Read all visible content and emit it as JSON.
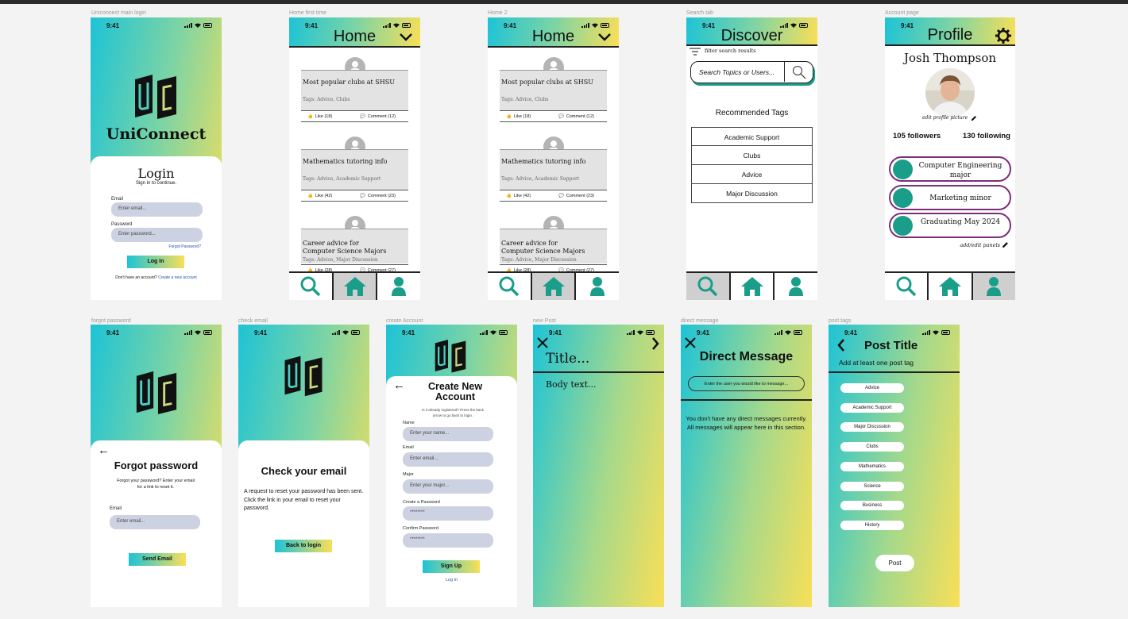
{
  "status_time": "9:41",
  "frames": {
    "login": {
      "name": "Uniconnect main login",
      "logo_text": "UC",
      "app_name": "UniConnect",
      "title": "Login",
      "subtitle": "Sign in to continue.",
      "email_label": "Email",
      "email_placeholder": "Enter email...",
      "password_label": "Password",
      "password_placeholder": "Enter password...",
      "forgot": "Forgot Password?",
      "login_btn": "Log In",
      "no_account": "Don't have an account?",
      "create_link": "Create a new account"
    },
    "home1": {
      "name": "Home first time",
      "title": "Home",
      "posts": [
        {
          "title": "Most popular clubs at SHSU",
          "tags": "Tags: Advice, Clubs",
          "likes": "Like (18)",
          "comments": "Comment (12)"
        },
        {
          "title": "Mathematics tutoring info",
          "tags": "Tags: Advice, Academic Support",
          "likes": "Like (42)",
          "comments": "Comment (23)"
        },
        {
          "title": "Career advice for Computer Science Majors",
          "tags": "Tags: Advice, Major Discussion",
          "likes": "Like (28)",
          "comments": "Comment (27)"
        }
      ]
    },
    "home2": {
      "name": "Home 2",
      "title": "Home"
    },
    "search": {
      "name": "Search tab",
      "title": "Discover",
      "filter": "filter search results",
      "search_placeholder": "Search Topics or Users...",
      "rec_title": "Recommended Tags",
      "tags": [
        "Academic Support",
        "Clubs",
        "Advice",
        "Major Discussion"
      ]
    },
    "account": {
      "name": "Account page",
      "title": "Profile",
      "user": "Josh Thompson",
      "edit_pic": "edit profile picture",
      "followers": "105 followers",
      "following": "130 following",
      "panels": [
        "Computer Engineering major",
        "Marketing minor",
        "Graduating May 2024"
      ],
      "edit_panels": "add/edit panels"
    },
    "forgot": {
      "name": "forgot password",
      "title": "Forgot password",
      "desc": "Forgot your password? Enter your email for a link to reset it.",
      "email_label": "Email",
      "email_placeholder": "Enter email...",
      "btn": "Send Email"
    },
    "check": {
      "name": "check email",
      "title": "Check your email",
      "desc": "A request to reset your password has been sent. Click the link in your email to reset your password.",
      "btn": "Back to login"
    },
    "create": {
      "name": "create Account",
      "title": "Create New Account",
      "desc": "Is it already registered? Press the back arrow to go back to login.",
      "fields": [
        {
          "label": "Name",
          "placeholder": "Enter your name..."
        },
        {
          "label": "Email",
          "placeholder": "Enter email..."
        },
        {
          "label": "Major",
          "placeholder": "Enter your major..."
        },
        {
          "label": "Create a Password",
          "placeholder": "********"
        },
        {
          "label": "Confirm Password",
          "placeholder": "********"
        }
      ],
      "btn": "Sign Up",
      "login_link": "Log In"
    },
    "newpost": {
      "name": "new Post",
      "title": "Title...",
      "body": "Body text..."
    },
    "dm": {
      "name": "direct message",
      "title": "Direct Message",
      "input_placeholder": "Enter the user you would like to message...",
      "empty": "You don't have any direct messages currently. All messages will appear here in this section."
    },
    "tags": {
      "name": "post tags",
      "title": "Post Title",
      "subtitle": "Add at least one post tag",
      "chips": [
        "Advice",
        "Academic Support",
        "Major Discussion",
        "Clubs",
        "Mathematics",
        "Science",
        "Business",
        "History"
      ],
      "btn": "Post"
    }
  }
}
